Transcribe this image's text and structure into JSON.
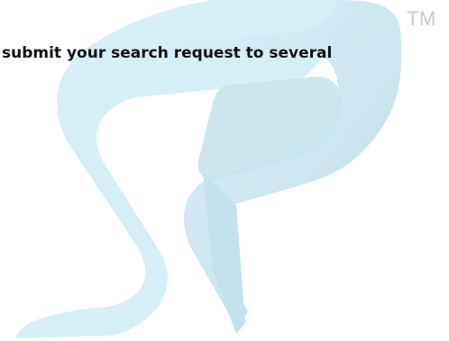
{
  "watermark": {
    "logo_letters": "SP",
    "trademark": "TM",
    "colors": {
      "light": "#d6eef6",
      "mid": "#c5e1eb",
      "shadow": "#b9cfd7"
    }
  },
  "banner": {
    "headline": "submit your search request to several"
  }
}
